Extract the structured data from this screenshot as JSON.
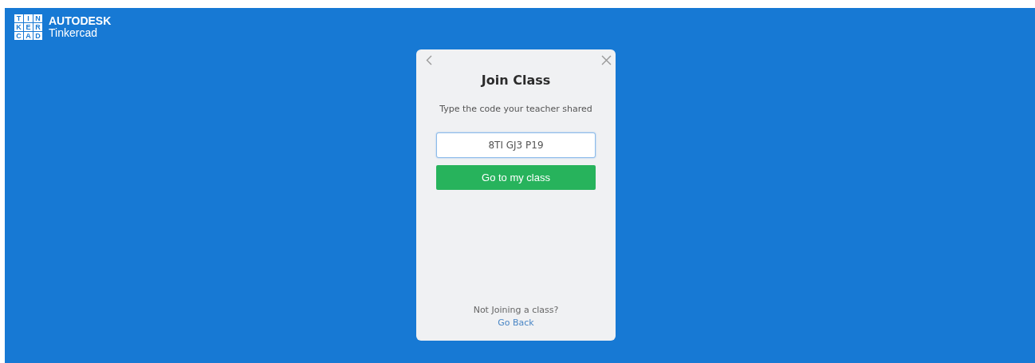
{
  "logo": {
    "tiles": [
      "T",
      "I",
      "N",
      "K",
      "E",
      "R",
      "C",
      "A",
      "D"
    ],
    "brand": "AUTODESK",
    "product": "Tinkercad"
  },
  "dialog": {
    "title": "Join Class",
    "subtitle": "Type the code your teacher shared",
    "code_field": {
      "value": "8TI GJ3 P19",
      "focused": true
    },
    "submit_button": "Go to my class",
    "footer_text": "Not Joining a class?",
    "footer_link": "Go Back"
  }
}
